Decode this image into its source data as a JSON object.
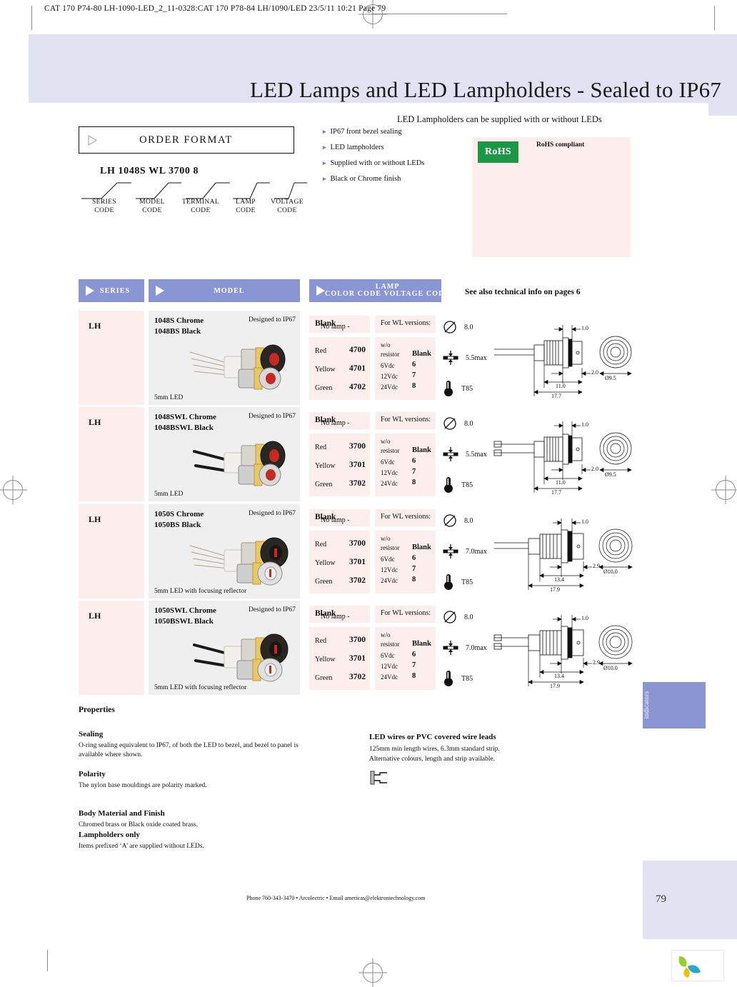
{
  "prepress_header": "CAT 170 P74-80 LH-1090-LED_2_11-0328:CAT 170 P78-84 LH/1090/LED   23/5/11  10:21  Page 79",
  "title": "LED Lamps and LED Lampholders - Sealed to IP67",
  "order_format": {
    "box_label": "ORDER FORMAT",
    "example_code": "LH 1048S WL 3700 8",
    "legend": [
      {
        "line1": "SERIES",
        "line2": "CODE"
      },
      {
        "line1": "MODEL",
        "line2": "CODE"
      },
      {
        "line1": "TERMINAL",
        "line2": "CODE"
      },
      {
        "line1": "LAMP",
        "line2": "CODE"
      },
      {
        "line1": "VOLTAGE",
        "line2": "CODE"
      }
    ]
  },
  "intro": {
    "subhead": "LED Lampholders can be supplied with or without LEDs",
    "bullets": [
      "IP67 front bezel sealing",
      "LED lampholders",
      "Supplied with or without LEDs",
      "Black or Chrome finish"
    ],
    "rohs_logo": "RoHS",
    "rohs_text": "RoHS compliant"
  },
  "see_also": "See also technical info on pages 6",
  "table": {
    "headers": {
      "series": "SERIES",
      "model": "MODEL",
      "lamp_line1": "LAMP",
      "lamp_line2": "COLOR CODE VOLTAGE CODE"
    },
    "rows": [
      {
        "series": "LH",
        "model_line1": "1048S Chrome",
        "model_line2": "1048BS Black",
        "ip_note": "Designed to IP67",
        "model_foot": "5mm LED",
        "no_lamp_label": "No lamp -",
        "no_lamp_value": "Blank",
        "colors": [
          {
            "name": "Red",
            "code": "4700"
          },
          {
            "name": "Yellow",
            "code": "4701"
          },
          {
            "name": "Green",
            "code": "4702"
          }
        ],
        "wl_header": "For WL versions:",
        "voltages": [
          {
            "label1": "w/o",
            "label2": "resistor",
            "code": "Blank"
          },
          {
            "label1": "6Vdc",
            "label2": "",
            "code": "6"
          },
          {
            "label1": "12Vdc",
            "label2": "",
            "code": "7"
          },
          {
            "label1": "24Vdc",
            "label2": "",
            "code": "8"
          }
        ],
        "spec_diameter": "8.0",
        "spec_panel": "5.5max",
        "spec_temp": "T85",
        "dim_a": "1.0",
        "dim_b": "2.0",
        "dim_c": "11.0",
        "dim_d": "17.7",
        "dim_front": "Ø9.5"
      },
      {
        "series": "LH",
        "model_line1": "1048SWL Chrome",
        "model_line2": "1048BSWL Black",
        "ip_note": "Designed to IP67",
        "model_foot": "5mm LED",
        "no_lamp_label": "No lamp -",
        "no_lamp_value": "Blank",
        "colors": [
          {
            "name": "Red",
            "code": "3700"
          },
          {
            "name": "Yellow",
            "code": "3701"
          },
          {
            "name": "Green",
            "code": "3702"
          }
        ],
        "wl_header": "For WL versions:",
        "voltages": [
          {
            "label1": "w/o",
            "label2": "resistor",
            "code": "Blank"
          },
          {
            "label1": "6Vdc",
            "label2": "",
            "code": "6"
          },
          {
            "label1": "12Vdc",
            "label2": "",
            "code": "7"
          },
          {
            "label1": "24Vdc",
            "label2": "",
            "code": "8"
          }
        ],
        "spec_diameter": "8.0",
        "spec_panel": "5.5max",
        "spec_temp": "T85",
        "dim_a": "1.0",
        "dim_b": "2.0",
        "dim_c": "11.0",
        "dim_d": "17.7",
        "dim_front": "Ø9.5"
      },
      {
        "series": "LH",
        "model_line1": "1050S Chrome",
        "model_line2": "1050BS Black",
        "ip_note": "Designed to IP67",
        "model_foot": "5mm LED with focusing reflector",
        "no_lamp_label": "No lamp -",
        "no_lamp_value": "Blank",
        "colors": [
          {
            "name": "Red",
            "code": "3700"
          },
          {
            "name": "Yellow",
            "code": "3701"
          },
          {
            "name": "Green",
            "code": "3702"
          }
        ],
        "wl_header": "For WL versions:",
        "voltages": [
          {
            "label1": "w/o",
            "label2": "resistor",
            "code": "Blank"
          },
          {
            "label1": "6Vdc",
            "label2": "",
            "code": "6"
          },
          {
            "label1": "12Vdc",
            "label2": "",
            "code": "7"
          },
          {
            "label1": "24Vdc",
            "label2": "",
            "code": "8"
          }
        ],
        "spec_diameter": "8.0",
        "spec_panel": "7.0max",
        "spec_temp": "T85",
        "dim_a": "1.0",
        "dim_b": "2.9",
        "dim_c": "13.4",
        "dim_d": "17.9",
        "dim_front": "Ø10.0"
      },
      {
        "series": "LH",
        "model_line1": "1050SWL Chrome",
        "model_line2": "1050BSWL Black",
        "ip_note": "Designed to IP67",
        "model_foot": "5mm LED with focusing reflector",
        "no_lamp_label": "No lamp -",
        "no_lamp_value": "Blank",
        "colors": [
          {
            "name": "Red",
            "code": "3700"
          },
          {
            "name": "Yellow",
            "code": "3701"
          },
          {
            "name": "Green",
            "code": "3702"
          }
        ],
        "wl_header": "For WL versions:",
        "voltages": [
          {
            "label1": "w/o",
            "label2": "resistor",
            "code": "Blank"
          },
          {
            "label1": "6Vdc",
            "label2": "",
            "code": "6"
          },
          {
            "label1": "12Vdc",
            "label2": "",
            "code": "7"
          },
          {
            "label1": "24Vdc",
            "label2": "",
            "code": "8"
          }
        ],
        "spec_diameter": "8.0",
        "spec_panel": "7.0max",
        "spec_temp": "T85",
        "dim_a": "1.0",
        "dim_b": "2.9",
        "dim_c": "13.4",
        "dim_d": "17.9",
        "dim_front": "Ø10.0"
      }
    ]
  },
  "properties": {
    "title": "Properties",
    "sections": [
      {
        "heading": "Sealing",
        "body": "O-ring sealing equivalent to IP67, of both the LED to bezel, and bezel to panel is available where shown."
      },
      {
        "heading": "Polarity",
        "body": "The nylon base mouldings are polarity marked."
      },
      {
        "heading": "Body Material and Finish",
        "body": "Chromed brass or Black oxide coated brass."
      },
      {
        "heading": "Lampholders only",
        "body": "Items prefixed ‘A’ are supplied without LEDs."
      }
    ],
    "wires": {
      "heading": "LED wires or PVC covered wire leads",
      "line1": "125mm min length wires, 6.3mm standard strip.",
      "line2": "Alternative colours, length and strip available."
    }
  },
  "side_tab": "indicators",
  "footer": "Phone 760-343-3470 • Arcolectric • Email americas@elektrontechnology.com",
  "page_number": "79",
  "colors": {
    "band": "#e2e2f2",
    "header": "#8a96d4",
    "cell_pink": "#fdeeee",
    "cell_gray": "#efefef",
    "rohs_green": "#1e9648"
  }
}
